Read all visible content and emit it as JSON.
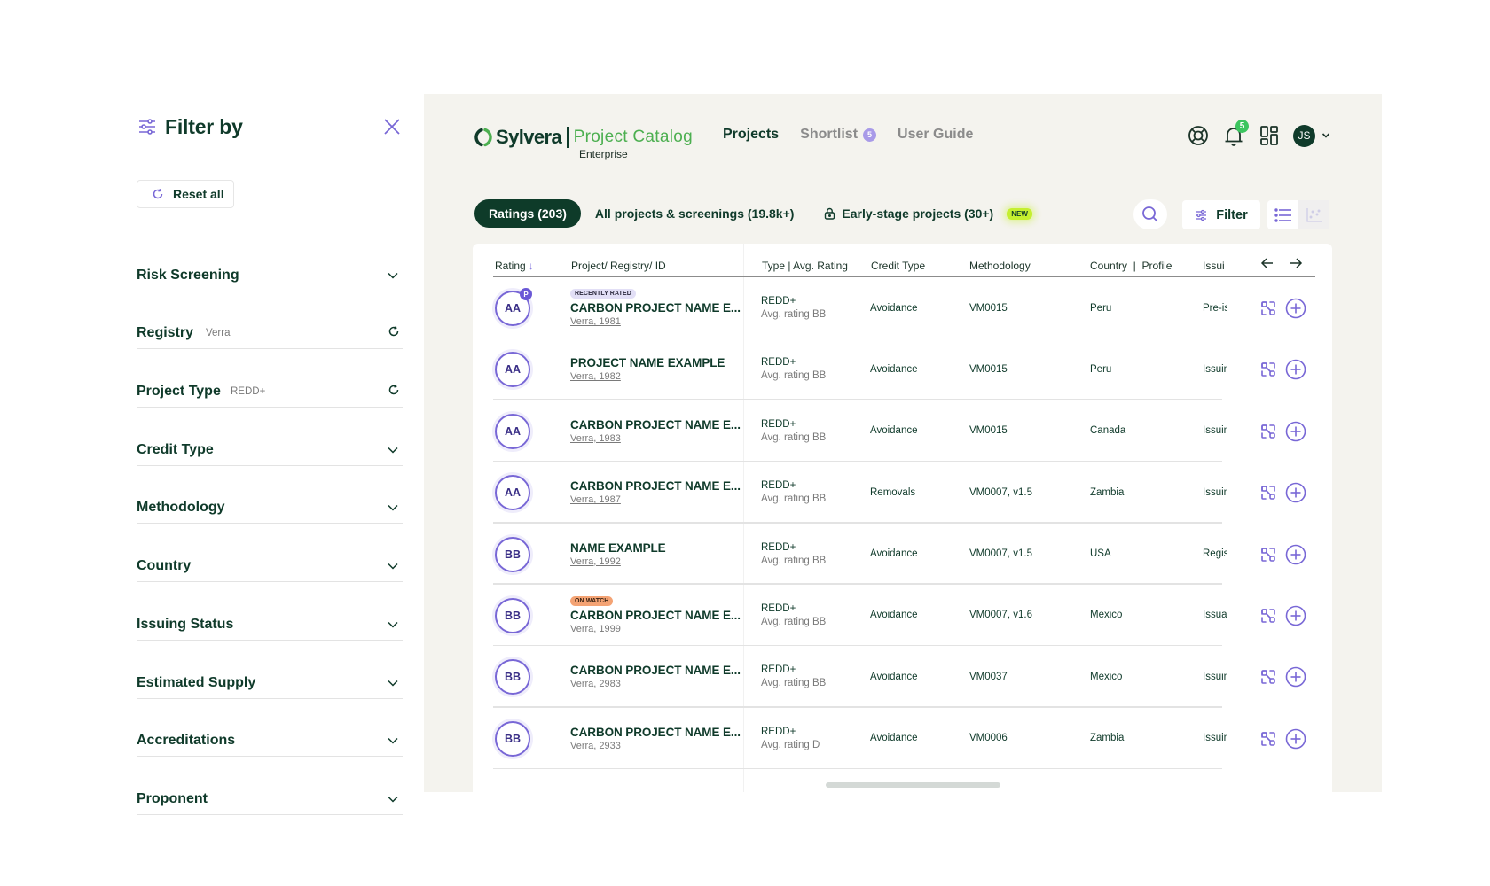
{
  "sidebar": {
    "title": "Filter by",
    "reset_label": "Reset all",
    "filters": [
      {
        "label": "Risk Screening",
        "selected": "",
        "control": "chevron-down"
      },
      {
        "label": "Registry",
        "selected": "Verra",
        "control": "reset"
      },
      {
        "label": "Project Type",
        "selected": "REDD+",
        "control": "reset"
      },
      {
        "label": "Credit Type",
        "selected": "",
        "control": "chevron-down"
      },
      {
        "label": "Methodology",
        "selected": "",
        "control": "chevron-down"
      },
      {
        "label": "Country",
        "selected": "",
        "control": "chevron-down"
      },
      {
        "label": "Issuing Status",
        "selected": "",
        "control": "chevron-down"
      },
      {
        "label": "Estimated Supply",
        "selected": "",
        "control": "chevron-down"
      },
      {
        "label": "Accreditations",
        "selected": "",
        "control": "chevron-down"
      },
      {
        "label": "Proponent",
        "selected": "",
        "control": "chevron-down"
      }
    ]
  },
  "header": {
    "brand": "Sylvera",
    "product": "Project Catalog",
    "edition": "Enterprise",
    "nav": [
      {
        "label": "Projects",
        "active": true
      },
      {
        "label": "Shortlist",
        "count": "5"
      },
      {
        "label": "User Guide"
      }
    ],
    "notifications_count": "5",
    "user_initials": "JS"
  },
  "tabs": [
    {
      "label": "Ratings (203)",
      "active": true
    },
    {
      "label": "All projects & screenings (19.8k+)"
    },
    {
      "label": "Early-stage projects (30+)",
      "locked": true,
      "badge": "NEW"
    }
  ],
  "toolbar": {
    "filter_label": "Filter"
  },
  "table": {
    "columns": [
      "Rating",
      "Project/ Registry/ ID",
      "Type | Avg. Rating",
      "Credit Type",
      "Methodology",
      "Country  |  Profile",
      "Issui"
    ],
    "sort_indicator": "↓",
    "rows": [
      {
        "rating": "AA",
        "rating_badge": "P",
        "tag": "RECENTLY RATED",
        "tag_kind": "recent",
        "name": "CARBON PROJECT NAME E...",
        "registry": "Verra, 1981",
        "type": "REDD+",
        "avg": "Avg. rating BB",
        "credit": "Avoidance",
        "method": "VM0015",
        "country": "Peru",
        "issuing": "Pre-is"
      },
      {
        "rating": "AA",
        "name": "PROJECT NAME EXAMPLE",
        "registry": "Verra, 1982",
        "type": "REDD+",
        "avg": "Avg. rating BB",
        "credit": "Avoidance",
        "method": "VM0015",
        "country": "Peru",
        "issuing": "Issuing"
      },
      {
        "rating": "AA",
        "name": "CARBON PROJECT NAME E...",
        "registry": "Verra, 1983",
        "type": "REDD+",
        "avg": "Avg. rating BB",
        "credit": "Avoidance",
        "method": "VM0015",
        "country": "Canada",
        "issuing": "Issuing"
      },
      {
        "rating": "AA",
        "name": "CARBON PROJECT NAME E...",
        "registry": "Verra, 1987",
        "type": "REDD+",
        "avg": "Avg. rating BB",
        "credit": "Removals",
        "method": "VM0007, v1.5",
        "country": "Zambia",
        "issuing": "Issuing"
      },
      {
        "rating": "BB",
        "name": "NAME EXAMPLE",
        "registry": "Verra, 1992",
        "type": "REDD+",
        "avg": "Avg. rating BB",
        "credit": "Avoidance",
        "method": "VM0007, v1.5",
        "country": "USA",
        "issuing": "Registered"
      },
      {
        "rating": "BB",
        "tag": "ON WATCH",
        "tag_kind": "watch",
        "name": "CARBON PROJECT NAME E...",
        "registry": "Verra, 1999",
        "type": "REDD+",
        "avg": "Avg. rating BB",
        "credit": "Avoidance",
        "method": "VM0007, v1.6",
        "country": "Mexico",
        "issuing": "Issuance"
      },
      {
        "rating": "BB",
        "name": "CARBON PROJECT NAME E...",
        "registry": "Verra, 2983",
        "type": "REDD+",
        "avg": "Avg. rating BB",
        "credit": "Avoidance",
        "method": "VM0037",
        "country": "Mexico",
        "issuing": "Issuing"
      },
      {
        "rating": "BB",
        "name": "CARBON PROJECT NAME E...",
        "registry": "Verra, 2933",
        "type": "REDD+",
        "avg": "Avg. rating D",
        "credit": "Avoidance",
        "method": "VM0006",
        "country": "Zambia",
        "issuing": "Issuing"
      }
    ]
  },
  "colors": {
    "brand_dark": "#0f3a2a",
    "brand_green": "#4caf50",
    "accent_purple": "#7867d6",
    "panel_bg": "#f4f3ee",
    "new_badge": "#c5ef2f",
    "on_watch": "#f4a374"
  }
}
